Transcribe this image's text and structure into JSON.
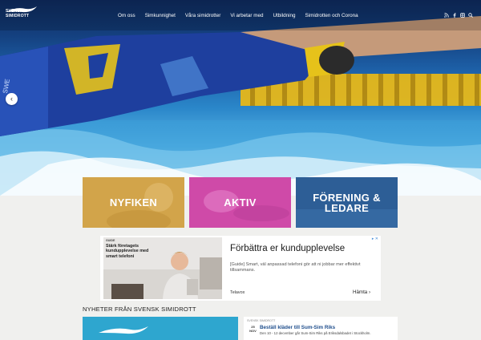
{
  "brand": {
    "logo_text_line1": "SVENSK",
    "logo_text_line2": "SIMIDROTT"
  },
  "nav": {
    "items": [
      "Om oss",
      "Simkunnighet",
      "Våra simidrotter",
      "Vi arbetar med",
      "Utbildning",
      "Simidrotten och Corona"
    ],
    "icons": [
      "rss-icon",
      "facebook-icon",
      "instagram-icon",
      "search-icon"
    ]
  },
  "hero": {
    "prev_label": "‹"
  },
  "tiles": [
    {
      "label": "NYFIKEN",
      "color": "#d2a44a"
    },
    {
      "label": "AKTIV",
      "color": "#cf4aa8"
    },
    {
      "label": "FÖRENING & LEDARE",
      "label_line1": "FÖRENING &",
      "label_line2": "LEDARE",
      "color": "#2d5e96"
    }
  ],
  "ad": {
    "image_label": "GUIDE",
    "image_headline": "Stärk företagets kundupplevelse med smart telefoni",
    "title": "Förbättra er kundupplevelse",
    "description": "[Guide] Smart, väl anpassad telefoni gör att ni jobbar mer effektivt tillsammans.",
    "source": "Telavox",
    "cta": "Hämta",
    "adchoices": "▸ ✕"
  },
  "news": {
    "section_title": "NYHETER FRÅN SVENSK SIMIDROTT",
    "card": {
      "category": "SVENSK SIMIDROTT",
      "date_day": "25",
      "date_month": "NOV",
      "title": "Beställ kläder till Sum-Sim Riks",
      "description": "Den 10 - 12 december går Sum-Sim Riks på Eriksdalsbadet i Stockholm."
    }
  }
}
